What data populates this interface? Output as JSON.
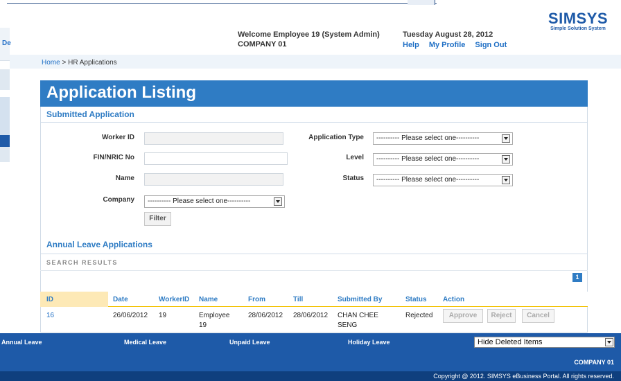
{
  "header": {
    "welcome_line1": "Welcome Employee 19 (System Admin)",
    "welcome_line2": "COMPANY 01",
    "date": "Tuesday August 28, 2012",
    "links": [
      "Help",
      "My Profile",
      "Sign Out"
    ],
    "logo_text": "SIMSYS",
    "logo_sub": "Simple Solution System",
    "left_ghost_text": "De"
  },
  "breadcrumb": {
    "home": "Home",
    "separator": " > ",
    "current": "HR Applications"
  },
  "page": {
    "title": "Application Listing",
    "section": "Submitted Application"
  },
  "form": {
    "worker_id_label": "Worker ID",
    "worker_id_value": "",
    "fin_label": "FIN/NRIC No",
    "fin_value": "",
    "name_label": "Name",
    "name_value": "",
    "company_label": "Company",
    "company_value": "---------- Please select one----------",
    "app_type_label": "Application Type",
    "app_type_value": "---------- Please select one----------",
    "level_label": "Level",
    "level_value": "---------- Please select one----------",
    "status_label": "Status",
    "status_value": "---------- Please select one----------",
    "filter_button": "Filter"
  },
  "results": {
    "section": "Annual Leave Applications",
    "search_results_label": "SEARCH RESULTS",
    "page_number": "1",
    "columns": [
      "ID",
      "Date",
      "WorkerID",
      "Name",
      "From",
      "Till",
      "Submitted By",
      "Status",
      "Action"
    ],
    "rows": [
      {
        "id": "16",
        "date": "26/06/2012",
        "worker_id": "19",
        "name_l1": "Employee",
        "name_l2": "19",
        "from": "28/06/2012",
        "till": "28/06/2012",
        "submitted_l1": "CHAN CHEE",
        "submitted_l2": "SENG",
        "status": "Rejected",
        "actions": [
          "Approve",
          "Reject",
          "Cancel"
        ]
      }
    ]
  },
  "bottom_nav": {
    "items": [
      "Annual Leave",
      "Medical Leave",
      "Unpaid Leave",
      "Holiday Leave"
    ],
    "hide_deleted": "Hide Deleted Items",
    "company": "COMPANY 01",
    "copyright": "Copyright @ 2012. SIMSYS eBusiness Portal. All rights reserved."
  },
  "colors": {
    "brand_blue": "#2f7cc4",
    "nav_blue": "#1e5aa8",
    "footer_blue": "#0f3f7e",
    "header_highlight": "#fde9b6"
  }
}
